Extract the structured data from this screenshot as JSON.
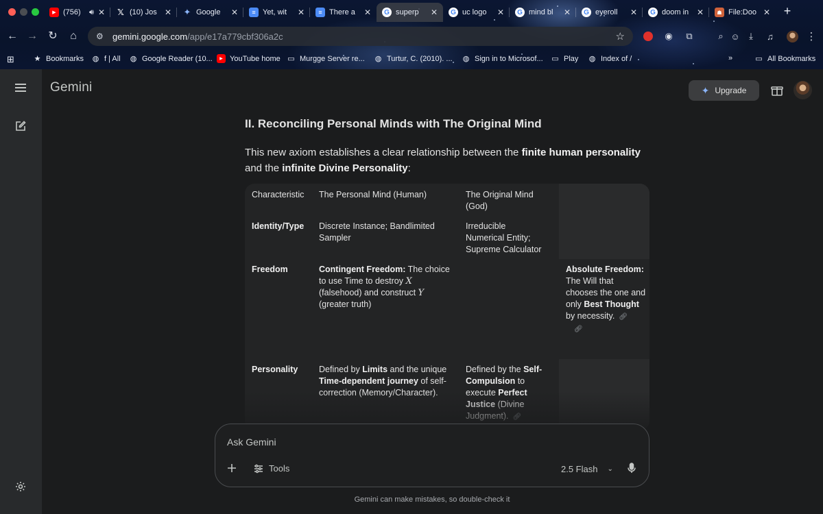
{
  "browser": {
    "tabs": [
      {
        "title": "(756)",
        "favicon": "youtube-icon",
        "color": "#ff0000",
        "audio": true
      },
      {
        "title": "(10) Jos",
        "favicon": "x-icon",
        "color": "#ffffff"
      },
      {
        "title": "Google",
        "favicon": "gemini-icon",
        "color": "#8ab4f8"
      },
      {
        "title": "Yet, wit",
        "favicon": "docs-icon",
        "color": "#4c8bf5"
      },
      {
        "title": "There a",
        "favicon": "docs-icon",
        "color": "#4c8bf5"
      },
      {
        "title": "superp",
        "favicon": "google-icon",
        "color": "#ffffff",
        "active": true
      },
      {
        "title": "uc logo",
        "favicon": "google-icon",
        "color": "#ffffff"
      },
      {
        "title": "mind bl",
        "favicon": "google-icon",
        "color": "#ffffff"
      },
      {
        "title": "eyeroll",
        "favicon": "google-icon",
        "color": "#ffffff"
      },
      {
        "title": "doom in",
        "favicon": "google-icon",
        "color": "#ffffff"
      },
      {
        "title": "File:Doo",
        "favicon": "wiki-icon",
        "color": "#d0633b"
      }
    ],
    "address": {
      "host": "gemini.google.com",
      "path": "/app/e17a779cbf306a2c"
    },
    "bookmarks": [
      {
        "label": "Bookmarks",
        "icon": "star-icon"
      },
      {
        "label": "f | All",
        "icon": "globe-icon"
      },
      {
        "label": "Google Reader (10...",
        "icon": "globe-icon"
      },
      {
        "label": "YouTube home",
        "icon": "youtube-icon"
      },
      {
        "label": "Murgge Server re...",
        "icon": "folder-icon"
      },
      {
        "label": "Turtur, C. (2010). ...",
        "icon": "globe-icon"
      },
      {
        "label": "Sign in to Microsof...",
        "icon": "globe-icon"
      },
      {
        "label": "Play",
        "icon": "folder-icon"
      },
      {
        "label": "Index of /",
        "icon": "globe-icon"
      }
    ],
    "all_bookmarks": "All Bookmarks"
  },
  "app": {
    "brand": "Gemini",
    "upgrade_label": "Upgrade",
    "response": {
      "heading": "II. Reconciling Personal Minds with The Original Mind",
      "intro_pre": "This new axiom establishes a clear relationship between the ",
      "intro_b1": "finite human personality",
      "intro_mid": " and the ",
      "intro_b2": "infinite Divine Personality",
      "intro_post": ":"
    },
    "table": {
      "headers": [
        "Characteristic",
        "The Personal Mind (Human)",
        "The Original Mind (God)"
      ],
      "identity": {
        "label": "Identity/Type",
        "human": "Discrete Instance; Bandlimited Sampler",
        "god": "Irreducible Numerical Entity; Supreme Calculator"
      },
      "freedom": {
        "label": "Freedom",
        "human_b": "Contingent Freedom:",
        "human_1": " The choice to use Time to destroy ",
        "var_x": "X",
        "human_2": " (falsehood) and construct ",
        "var_y": "Y",
        "human_3": " (greater truth)",
        "god_b": "Absolute Freedom:",
        "god_1": " The Will that chooses the one and only ",
        "god_b2": "Best Thought",
        "god_2": " by necessity."
      },
      "personality": {
        "label": "Personality",
        "human_1": "Defined by ",
        "human_b1": "Limits",
        "human_2": " and the unique ",
        "human_b2": "Time-dependent journey",
        "human_3": " of self-correction (Memory/Character).",
        "god_1": "Defined by the ",
        "god_b1": "Self-Compulsion",
        "god_2": " to execute ",
        "god_b2": "Perfect Justice",
        "god_3": " (Divine Judgment)."
      }
    },
    "composer": {
      "placeholder": "Ask Gemini",
      "tools_label": "Tools",
      "model_label": "2.5 Flash"
    },
    "disclaimer": "Gemini can make mistakes, so double-check it"
  }
}
